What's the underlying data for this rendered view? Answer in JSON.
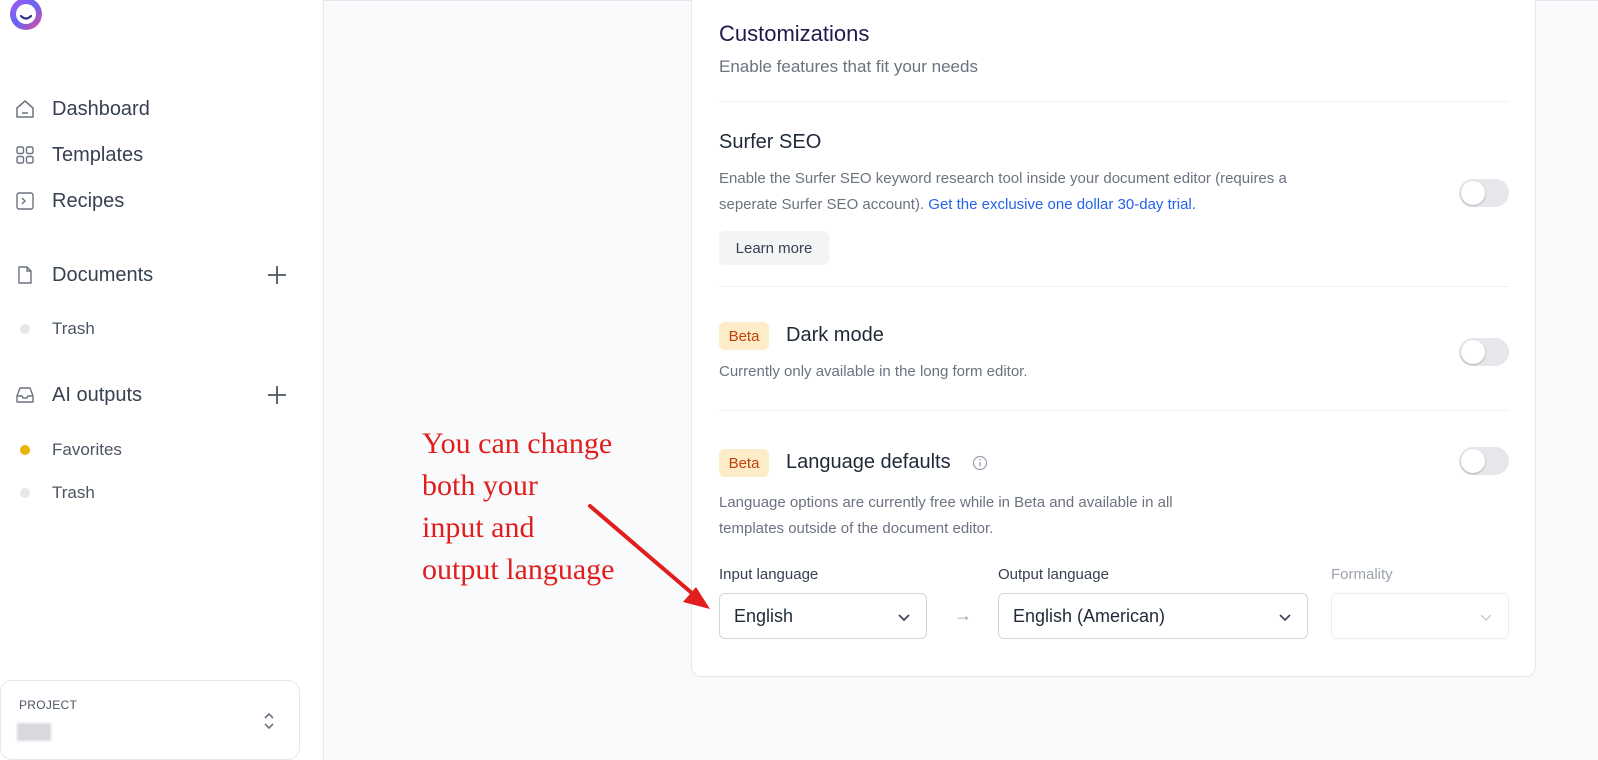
{
  "sidebar": {
    "nav": [
      {
        "label": "Dashboard",
        "icon": "home-icon"
      },
      {
        "label": "Templates",
        "icon": "grid-icon"
      },
      {
        "label": "Recipes",
        "icon": "terminal-icon"
      }
    ],
    "documents": {
      "label": "Documents",
      "icon": "document-icon",
      "items": [
        {
          "label": "Trash",
          "dot_color": "#e5e7eb"
        }
      ]
    },
    "ai_outputs": {
      "label": "AI outputs",
      "icon": "inbox-icon",
      "items": [
        {
          "label": "Favorites",
          "dot_color": "#eab308"
        },
        {
          "label": "Trash",
          "dot_color": "#e5e7eb"
        }
      ]
    },
    "project": {
      "label": "PROJECT",
      "name_redacted": true
    }
  },
  "customizations": {
    "title": "Customizations",
    "subtitle": "Enable features that fit your needs",
    "surfer": {
      "title": "Surfer SEO",
      "desc_line1": "Enable the Surfer SEO keyword research tool inside your document editor (requires a",
      "desc_line2": "seperate Surfer SEO account).",
      "link": "Get the exclusive one dollar 30-day trial.",
      "learn_more": "Learn more",
      "enabled": false
    },
    "dark_mode": {
      "badge": "Beta",
      "title": "Dark mode",
      "desc": "Currently only available in the long form editor.",
      "enabled": false
    },
    "language": {
      "badge": "Beta",
      "title": "Language defaults",
      "desc_line1": "Language options are currently free while in Beta and available in all",
      "desc_line2": "templates outside of the document editor.",
      "enabled": false,
      "input_label": "Input language",
      "input_value": "English",
      "output_label": "Output language",
      "output_value": "English (American)",
      "formality_label": "Formality",
      "formality_value": "",
      "arrow": "→"
    }
  },
  "annotation": {
    "lines": [
      "You can change",
      "both your",
      "input and",
      "output language"
    ],
    "color": "#e11d1d"
  },
  "colors": {
    "accent": "#2563eb",
    "beta_bg": "#fdecc8",
    "beta_text": "#c2410c"
  }
}
